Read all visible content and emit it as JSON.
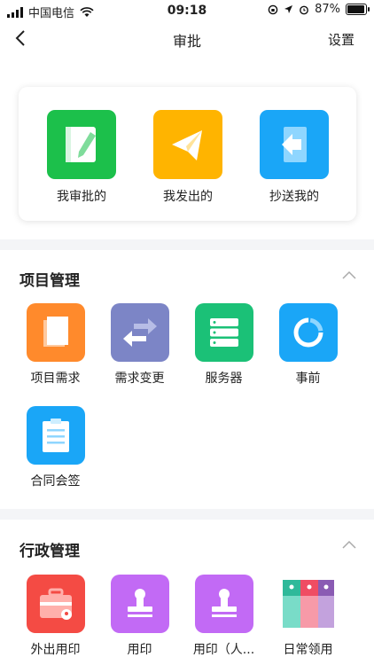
{
  "status": {
    "carrier": "中国电信",
    "time": "09:18",
    "battery": "87%",
    "battery_level": 0.87
  },
  "nav": {
    "title": "审批",
    "settings": "设置"
  },
  "quick": [
    {
      "label": "我审批的",
      "icon": "notebook-pen-icon",
      "color": "#1cc04b"
    },
    {
      "label": "我发出的",
      "icon": "paper-plane-icon",
      "color": "#ffb400"
    },
    {
      "label": "抄送我的",
      "icon": "door-arrow-icon",
      "color": "#1aa6f7"
    }
  ],
  "sections": [
    {
      "title": "项目管理",
      "apps": [
        {
          "label": "项目需求",
          "icon": "document-icon",
          "color": "#ff8a2c"
        },
        {
          "label": "需求变更",
          "icon": "swap-arrows-icon",
          "color": "#7c85c6"
        },
        {
          "label": "服务器",
          "icon": "server-icon",
          "color": "#1bc177"
        },
        {
          "label": "事前",
          "icon": "ring-icon",
          "color": "#1aa6f7"
        },
        {
          "label": "合同会签",
          "icon": "clipboard-icon",
          "color": "#1aa6f7"
        }
      ]
    },
    {
      "title": "行政管理",
      "apps": [
        {
          "label": "外出用印",
          "icon": "briefcase-stamp-icon",
          "color": "#f44b44"
        },
        {
          "label": "用印",
          "icon": "stamp-icon",
          "color": "#c26af5"
        },
        {
          "label": "用印（人...",
          "icon": "stamp-icon",
          "color": "#c26af5"
        },
        {
          "label": "日常领用",
          "icon": "binders-icon",
          "color": "#ffffff"
        }
      ]
    }
  ]
}
